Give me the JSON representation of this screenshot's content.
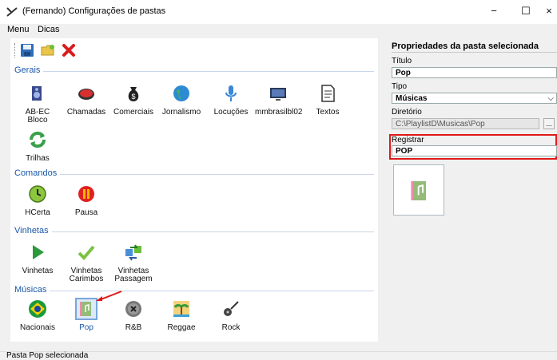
{
  "window": {
    "title": "(Fernando) Configurações de pastas",
    "min_glyph": "−",
    "max_glyph": "☐",
    "close_glyph": "×"
  },
  "menu": {
    "items": [
      "Menu",
      "Dicas"
    ]
  },
  "groups": [
    {
      "title": "Gerais",
      "items": [
        {
          "label": "AB-EC Bloco",
          "icon": "speaker-icon"
        },
        {
          "label": "Chamadas",
          "icon": "red-disc-icon"
        },
        {
          "label": "Comerciais",
          "icon": "money-bag-icon"
        },
        {
          "label": "Jornalismo",
          "icon": "globe-icon"
        },
        {
          "label": "Locuções",
          "icon": "microphone-icon"
        },
        {
          "label": "mmbrasilbl02",
          "icon": "monitor-icon"
        },
        {
          "label": "Textos",
          "icon": "document-icon"
        },
        {
          "label": "Trilhas",
          "icon": "refresh-icon"
        }
      ]
    },
    {
      "title": "Comandos",
      "items": [
        {
          "label": "HCerta",
          "icon": "clock-icon"
        },
        {
          "label": "Pausa",
          "icon": "pause-icon"
        }
      ]
    },
    {
      "title": "Vinhetas",
      "items": [
        {
          "label": "Vinhetas",
          "icon": "play-arrow-icon"
        },
        {
          "label": "Vinhetas Carimbos",
          "icon": "checkmark-icon"
        },
        {
          "label": "Vinhetas Passagem",
          "icon": "transfer-icon"
        }
      ]
    },
    {
      "title": "Músicas",
      "items": [
        {
          "label": "Nacionais",
          "icon": "brazil-flag-icon"
        },
        {
          "label": "Pop",
          "icon": "music-book-icon"
        },
        {
          "label": "R&B",
          "icon": "vinyl-icon"
        },
        {
          "label": "Reggae",
          "icon": "island-icon"
        },
        {
          "label": "Rock",
          "icon": "guitar-icon"
        }
      ]
    }
  ],
  "selected_folder": "Pop",
  "properties": {
    "section_title": "Propriedades da pasta selecionada",
    "titulo_label": "Título",
    "titulo_value": "Pop",
    "tipo_label": "Tipo",
    "tipo_value": "Músicas",
    "diretorio_label": "Diretório",
    "diretorio_value": "C:\\PlaylistD\\Musicas\\Pop",
    "browse_label": "...",
    "registrar_label": "Registrar",
    "registrar_value": "POP"
  },
  "status": {
    "text": "Pasta Pop selecionada"
  },
  "colors": {
    "group_title": "#1a57a8",
    "highlight": "#e01818",
    "selection": "#dbe9f8"
  }
}
